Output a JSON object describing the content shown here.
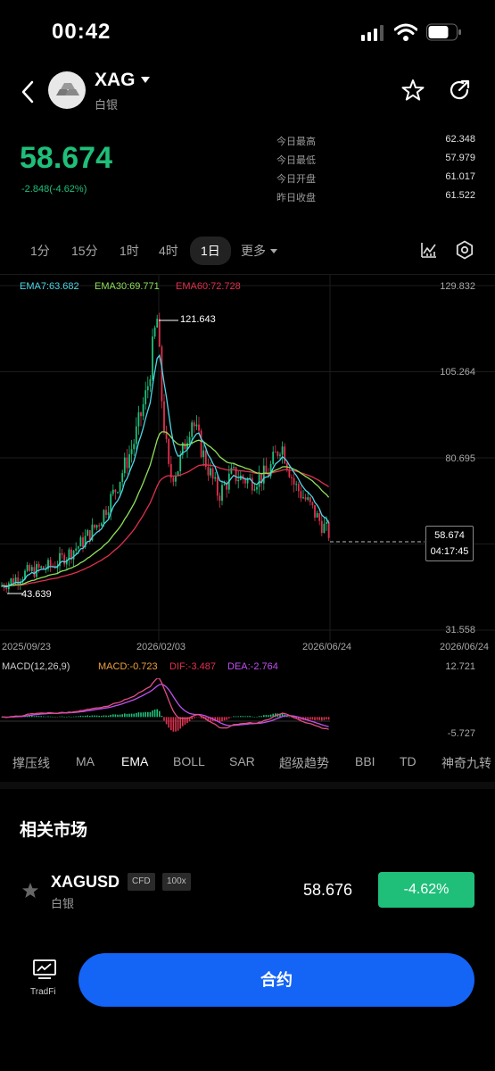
{
  "status_bar": {
    "time": "00:42"
  },
  "header": {
    "symbol": "XAG",
    "name": "白银"
  },
  "quote": {
    "price": "58.674",
    "change": "-2.848(-4.62%)",
    "stats": [
      {
        "label": "今日最高",
        "value": "62.348"
      },
      {
        "label": "今日最低",
        "value": "57.979"
      },
      {
        "label": "今日开盘",
        "value": "61.017"
      },
      {
        "label": "昨日收盘",
        "value": "61.522"
      }
    ]
  },
  "timeframes": [
    "1分",
    "15分",
    "1时",
    "4时",
    "1日",
    "更多"
  ],
  "active_timeframe": "1日",
  "chart": {
    "ema_labels": {
      "ema7": "EMA7:63.682",
      "ema30": "EMA30:69.771",
      "ema60": "EMA60:72.728"
    },
    "y_ticks": [
      "129.832",
      "105.264",
      "80.695",
      "31.558"
    ],
    "x_ticks": [
      "2025/09/23",
      "2026/02/03",
      "2026/06/24",
      "2026/06/24"
    ],
    "high_marker": "121.643",
    "low_marker": "43.639",
    "current_price": "58.674",
    "countdown": "04:17:45",
    "macd_labels": {
      "macd": "MACD(12,26,9)",
      "value": "MACD:-0.723",
      "dif": "DIF:-3.487",
      "dea": "DEA:-2.764"
    },
    "macd_y_ticks": [
      "12.721",
      "-5.727"
    ],
    "colors": {
      "up": "#1fbf7a",
      "down": "#e0304e",
      "ema7": "#4fd6e6",
      "ema30": "#8fe05a",
      "ema60": "#e0304e"
    }
  },
  "chart_data": {
    "type": "line",
    "title": "",
    "x": [
      "2025/09/23",
      "2026/02/03",
      "2026/06/24"
    ],
    "series": [
      {
        "name": "EMA7",
        "values": [
          44,
          118,
          60
        ]
      },
      {
        "name": "EMA30",
        "values": [
          42,
          90,
          70
        ]
      },
      {
        "name": "EMA60",
        "values": [
          40,
          80,
          73
        ]
      }
    ],
    "ylim": [
      31.558,
      129.832
    ]
  },
  "indicators": [
    "撑压线",
    "MA",
    "EMA",
    "BOLL",
    "SAR",
    "超级趋势",
    "BBI",
    "TD",
    "神奇九转"
  ],
  "active_indicator": "EMA",
  "related": {
    "title": "相关市场",
    "items": [
      {
        "symbol": "XAGUSD",
        "name": "白银",
        "tags": [
          "CFD",
          "100x"
        ],
        "price": "58.676",
        "change": "-4.62%"
      }
    ]
  },
  "bottom": {
    "tradfi": "TradFi",
    "trade_button": "合约"
  }
}
